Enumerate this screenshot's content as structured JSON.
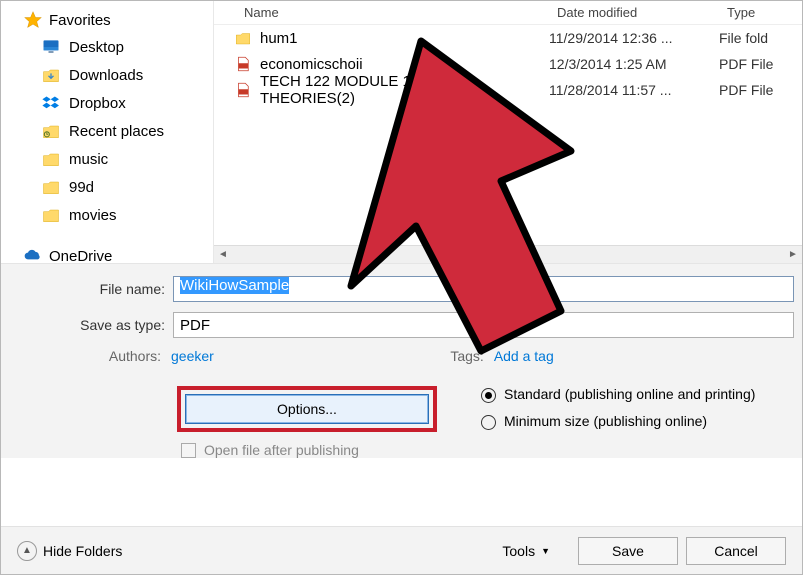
{
  "sidebar": {
    "favorites": {
      "label": "Favorites",
      "items": [
        {
          "label": "Desktop"
        },
        {
          "label": "Downloads"
        },
        {
          "label": "Dropbox"
        },
        {
          "label": "Recent places"
        },
        {
          "label": "music"
        },
        {
          "label": "99d"
        },
        {
          "label": "movies"
        }
      ]
    },
    "onedrive": {
      "label": "OneDrive"
    }
  },
  "columns": {
    "name": "Name",
    "date": "Date modified",
    "type": "Type"
  },
  "files": [
    {
      "name": "hum1",
      "date": "11/29/2014 12:36 ...",
      "type": "File fold",
      "kind": "folder"
    },
    {
      "name": "economicschoii",
      "date": "12/3/2014 1:25 AM",
      "type": "PDF File",
      "kind": "pdf"
    },
    {
      "name": "TECH 122 MODULE 1 COLOR THEORIES(2)",
      "date": "11/28/2014 11:57 ...",
      "type": "PDF File",
      "kind": "pdf"
    }
  ],
  "form": {
    "filename_label": "File name:",
    "filename_value": "WikiHowSample",
    "savetype_label": "Save as type:",
    "savetype_value": "PDF"
  },
  "meta": {
    "authors_label": "Authors:",
    "authors_value": "geeker",
    "tags_label": "Tags:",
    "tags_value": "Add a tag"
  },
  "options_button": "Options...",
  "open_after_label": "Open file after publishing",
  "optimize": {
    "standard": "Standard (publishing online and printing)",
    "minimum": "Minimum size (publishing online)"
  },
  "footer": {
    "hide_folders": "Hide Folders",
    "tools": "Tools",
    "save": "Save",
    "cancel": "Cancel"
  }
}
